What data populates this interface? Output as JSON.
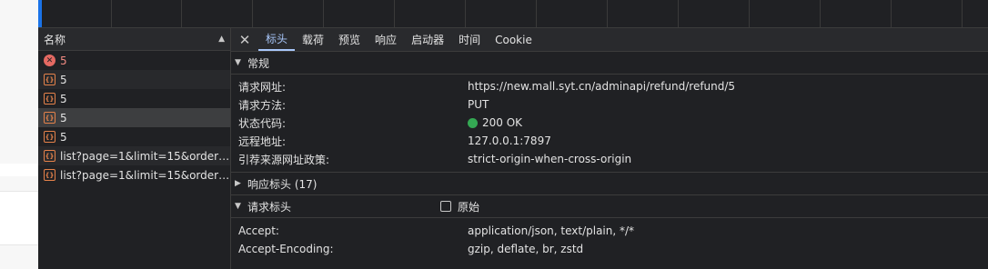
{
  "request_list": {
    "header": "名称",
    "rows": [
      {
        "name": "5",
        "type": "error"
      },
      {
        "name": "5",
        "type": "xhr"
      },
      {
        "name": "5",
        "type": "xhr"
      },
      {
        "name": "5",
        "type": "xhr"
      },
      {
        "name": "5",
        "type": "xhr"
      },
      {
        "name": "list?page=1&limit=15&order_...",
        "type": "xhr"
      },
      {
        "name": "list?page=1&limit=15&order_...",
        "type": "xhr"
      }
    ]
  },
  "tabs": [
    "标头",
    "载荷",
    "预览",
    "响应",
    "启动器",
    "时间",
    "Cookie"
  ],
  "general": {
    "title": "常规",
    "request_url_label": "请求网址:",
    "request_url": "https://new.mall.syt.cn/adminapi/refund/refund/5",
    "method_label": "请求方法:",
    "method": "PUT",
    "status_label": "状态代码:",
    "status": "200 OK",
    "remote_label": "远程地址:",
    "remote": "127.0.0.1:7897",
    "referrer_label": "引荐来源网址政策:",
    "referrer": "strict-origin-when-cross-origin"
  },
  "response_headers": {
    "title": "响应标头 (17)"
  },
  "request_headers": {
    "title": "请求标头",
    "raw_label": "原始",
    "accept_label": "Accept:",
    "accept": "application/json, text/plain, */*",
    "encoding_label": "Accept-Encoding:",
    "encoding": "gzip, deflate, br, zstd"
  },
  "colors": {
    "accent": "#a8c7fa",
    "status_ok": "#34a853",
    "error": "#e46962",
    "xhr": "#e5824a"
  }
}
